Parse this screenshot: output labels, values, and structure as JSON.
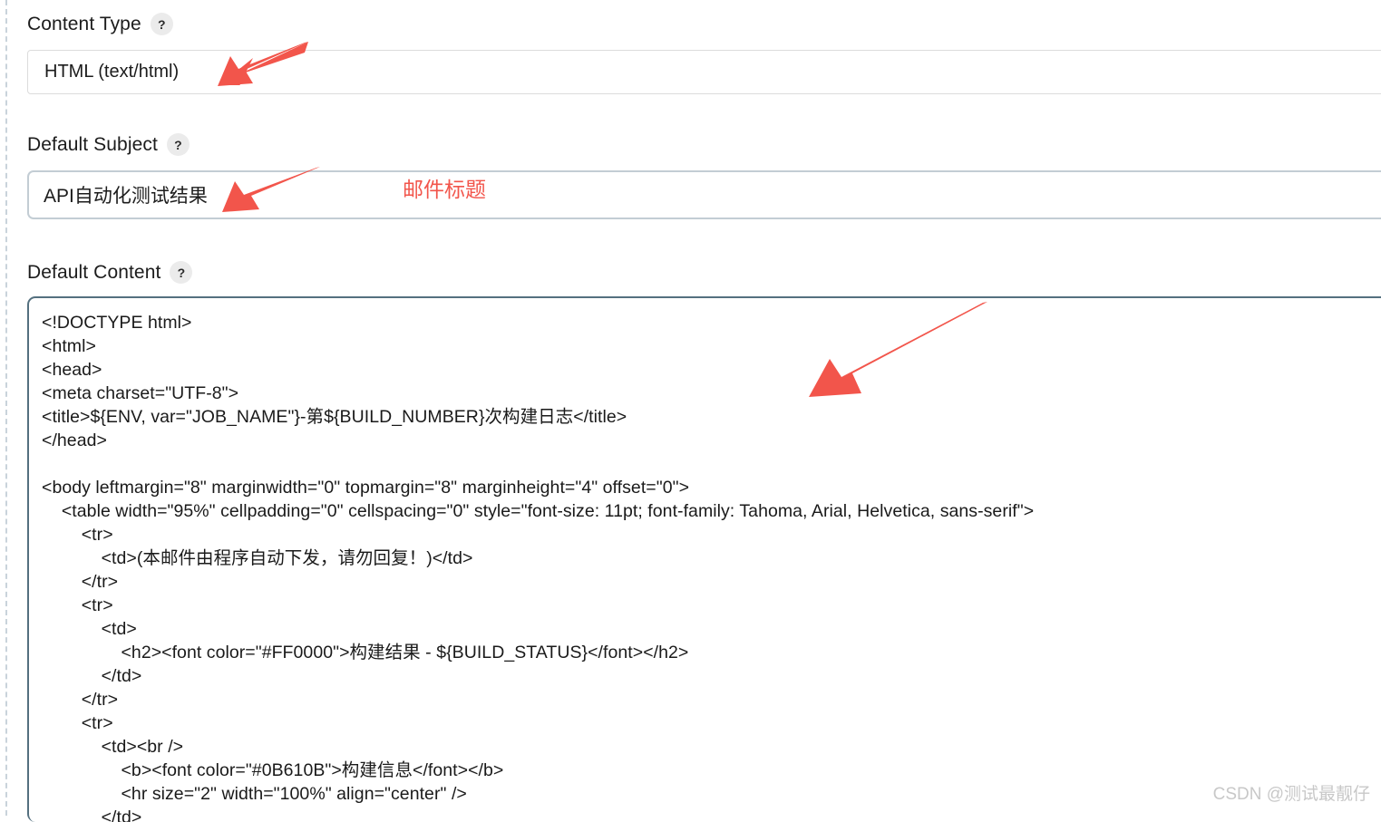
{
  "fields": {
    "content_type": {
      "label": "Content Type",
      "help": "?",
      "value": "HTML (text/html)"
    },
    "default_subject": {
      "label": "Default Subject",
      "help": "?",
      "value": "API自动化测试结果"
    },
    "default_content": {
      "label": "Default Content",
      "help": "?",
      "lines": [
        "<!DOCTYPE html>",
        "<html>",
        "<head>",
        "<meta charset=\"UTF-8\">",
        "<title>${ENV, var=\"JOB_NAME\"}-第${BUILD_NUMBER}次构建日志</title>",
        "</head>",
        "",
        "<body leftmargin=\"8\" marginwidth=\"0\" topmargin=\"8\" marginheight=\"4\" offset=\"0\">",
        "    <table width=\"95%\" cellpadding=\"0\" cellspacing=\"0\" style=\"font-size: 11pt; font-family: Tahoma, Arial, Helvetica, sans-serif\">",
        "        <tr>",
        "            <td>(本邮件由程序自动下发，请勿回复！)</td>",
        "        </tr>",
        "        <tr>",
        "            <td>",
        "                <h2><font color=\"#FF0000\">构建结果 - ${BUILD_STATUS}</font></h2>",
        "            </td>",
        "        </tr>",
        "        <tr>",
        "            <td><br />",
        "                <b><font color=\"#0B610B\">构建信息</font></b>",
        "                <hr size=\"2\" width=\"100%\" align=\"center\" />",
        "            </td>"
      ]
    }
  },
  "annotations": {
    "subject_note": "邮件标题",
    "color": "#f2554b"
  },
  "watermark": {
    "text": "CSDN @测试最靓仔"
  }
}
